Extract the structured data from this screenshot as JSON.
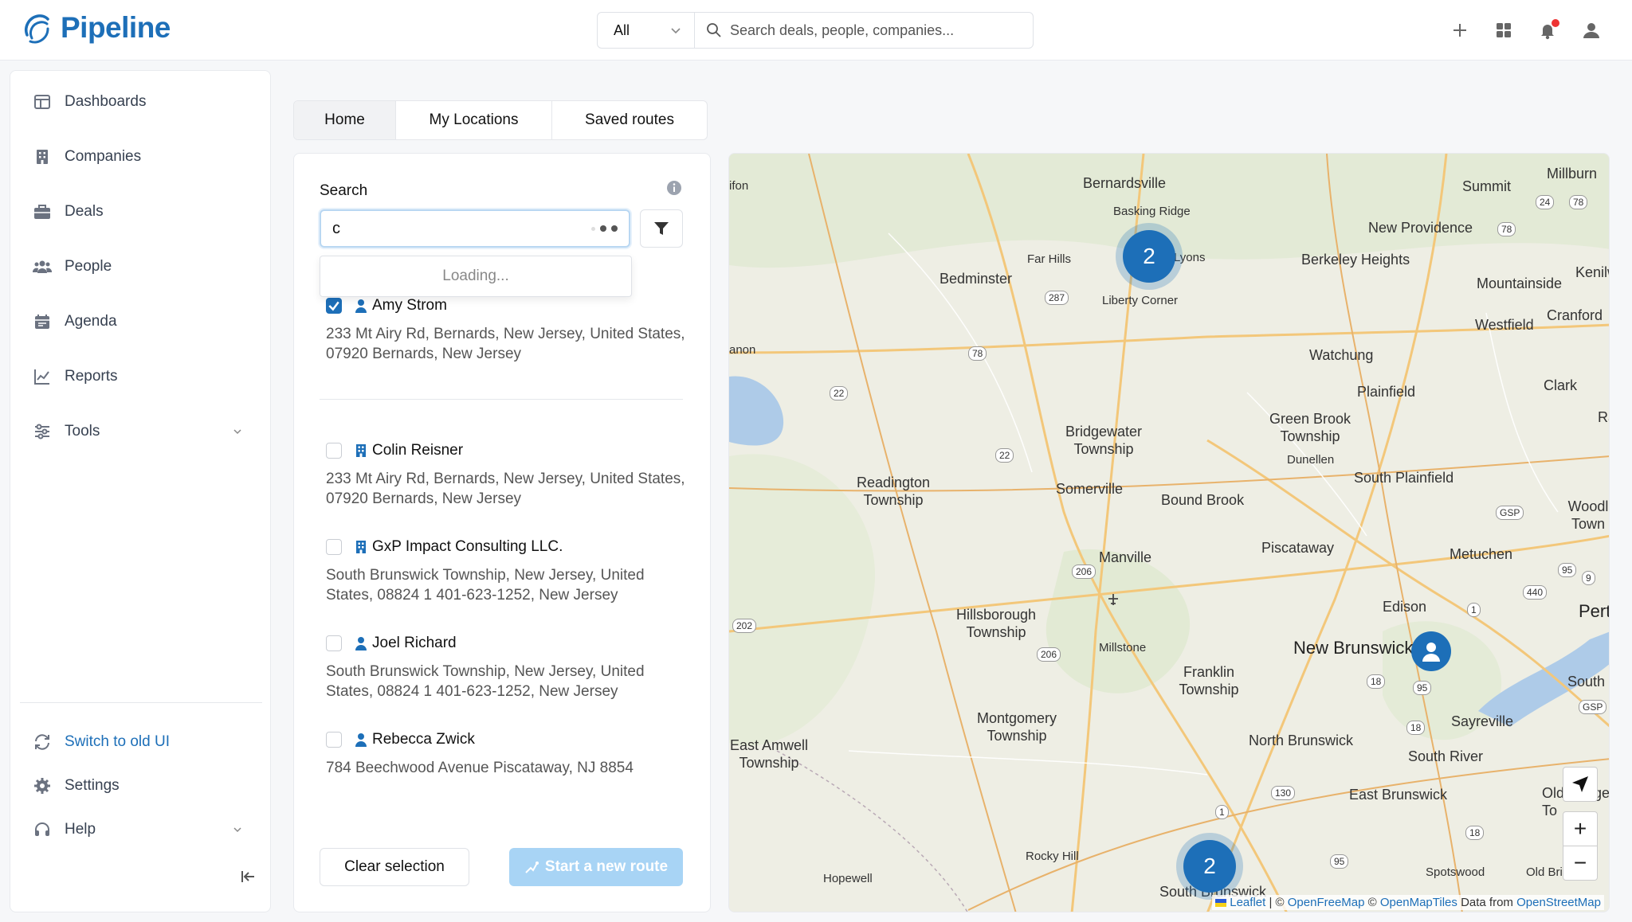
{
  "app": {
    "name": "Pipeline"
  },
  "topbar": {
    "scope_value": "All",
    "search_placeholder": "Search deals, people, companies..."
  },
  "sidebar": {
    "items": [
      {
        "label": "Dashboards",
        "icon": "dashboard-icon"
      },
      {
        "label": "Companies",
        "icon": "building-icon"
      },
      {
        "label": "Deals",
        "icon": "briefcase-icon"
      },
      {
        "label": "People",
        "icon": "people-icon"
      },
      {
        "label": "Agenda",
        "icon": "calendar-icon"
      },
      {
        "label": "Reports",
        "icon": "chart-line-icon"
      },
      {
        "label": "Tools",
        "icon": "sliders-icon"
      }
    ],
    "bottom": [
      {
        "label": "Switch to old UI",
        "icon": "refresh-icon"
      },
      {
        "label": "Settings",
        "icon": "gear-icon"
      },
      {
        "label": "Help",
        "icon": "headset-icon"
      }
    ]
  },
  "tabs": [
    "Home",
    "My Locations",
    "Saved routes"
  ],
  "panel": {
    "search_label": "Search",
    "search_value": "c",
    "dropdown_text": "Loading...",
    "results": [
      {
        "name": "Amy Strom",
        "type": "person",
        "checked": true,
        "address": "233 Mt Airy Rd, Bernards, New Jersey, United States, 07920 Bernards, New Jersey"
      },
      {
        "name": "Colin Reisner",
        "type": "company",
        "checked": false,
        "address": "233 Mt Airy Rd, Bernards, New Jersey, United States, 07920 Bernards, New Jersey"
      },
      {
        "name": "GxP Impact Consulting LLC.",
        "type": "company",
        "checked": false,
        "address": "South Brunswick Township, New Jersey, United States, 08824 1 401-623-1252, New Jersey"
      },
      {
        "name": "Joel Richard",
        "type": "person",
        "checked": false,
        "address": "South Brunswick Township, New Jersey, United States, 08824 1 401-623-1252, New Jersey"
      },
      {
        "name": "Rebecca Zwick",
        "type": "person",
        "checked": false,
        "address": "784 Beechwood Avenue Piscataway, NJ 8854"
      }
    ],
    "clear_label": "Clear selection",
    "start_label": "Start a new route"
  },
  "map": {
    "places": [
      {
        "t": "Bernardsville"
      },
      {
        "t": "Basking Ridge"
      },
      {
        "t": "Far Hills"
      },
      {
        "t": "Lyons"
      },
      {
        "t": "Bedminster"
      },
      {
        "t": "Liberty Corner"
      },
      {
        "t": "Summit"
      },
      {
        "t": "Millburn"
      },
      {
        "t": "New Providence"
      },
      {
        "t": "Berkeley Heights"
      },
      {
        "t": "Mountainside"
      },
      {
        "t": "Kenilw"
      },
      {
        "t": "Cranford"
      },
      {
        "t": "Westfield"
      },
      {
        "t": "Watchung"
      },
      {
        "t": "Plainfield"
      },
      {
        "t": "Clark"
      },
      {
        "t": "Ra"
      },
      {
        "t": "Green Brook Township"
      },
      {
        "t": "Dunellen"
      },
      {
        "t": "Bridgewater Township"
      },
      {
        "t": "Readington Township"
      },
      {
        "t": "Somerville"
      },
      {
        "t": "Bound Brook"
      },
      {
        "t": "South Plainfield"
      },
      {
        "t": "Woodl Town"
      },
      {
        "t": "Piscataway"
      },
      {
        "t": "Metuchen"
      },
      {
        "t": "Manville"
      },
      {
        "t": "Edison"
      },
      {
        "t": "Pert"
      },
      {
        "t": "Hillsborough Township"
      },
      {
        "t": "Millstone"
      },
      {
        "t": "New Brunswick"
      },
      {
        "t": "Franklin Township"
      },
      {
        "t": "South"
      },
      {
        "t": "Montgomery Township"
      },
      {
        "t": "Sayreville"
      },
      {
        "t": "East Amwell Township"
      },
      {
        "t": "North Brunswick"
      },
      {
        "t": "South River"
      },
      {
        "t": "East Brunswick"
      },
      {
        "t": "Old Bridge To"
      },
      {
        "t": "Rocky Hill"
      },
      {
        "t": "Hopewell"
      },
      {
        "t": "Spotswood"
      },
      {
        "t": "Old Bridge"
      },
      {
        "t": "South Brunswick"
      },
      {
        "t": "ifon"
      },
      {
        "t": "anon"
      }
    ],
    "shields": [
      "24",
      "78",
      "78",
      "287",
      "78",
      "22",
      "22",
      "206",
      "206",
      "202",
      "GSP",
      "95",
      "9",
      "440",
      "1",
      "18",
      "95",
      "18",
      "GSP",
      "130",
      "1",
      "95",
      "18"
    ],
    "clusters": [
      "2",
      "2"
    ],
    "attribution": {
      "leaflet": "Leaflet",
      "sep1": "| ©",
      "openfreemap": "OpenFreeMap",
      "copy2": "©",
      "openmaptiles": "OpenMapTiles",
      "data_from": "Data from",
      "osm": "OpenStreetMap"
    }
  }
}
